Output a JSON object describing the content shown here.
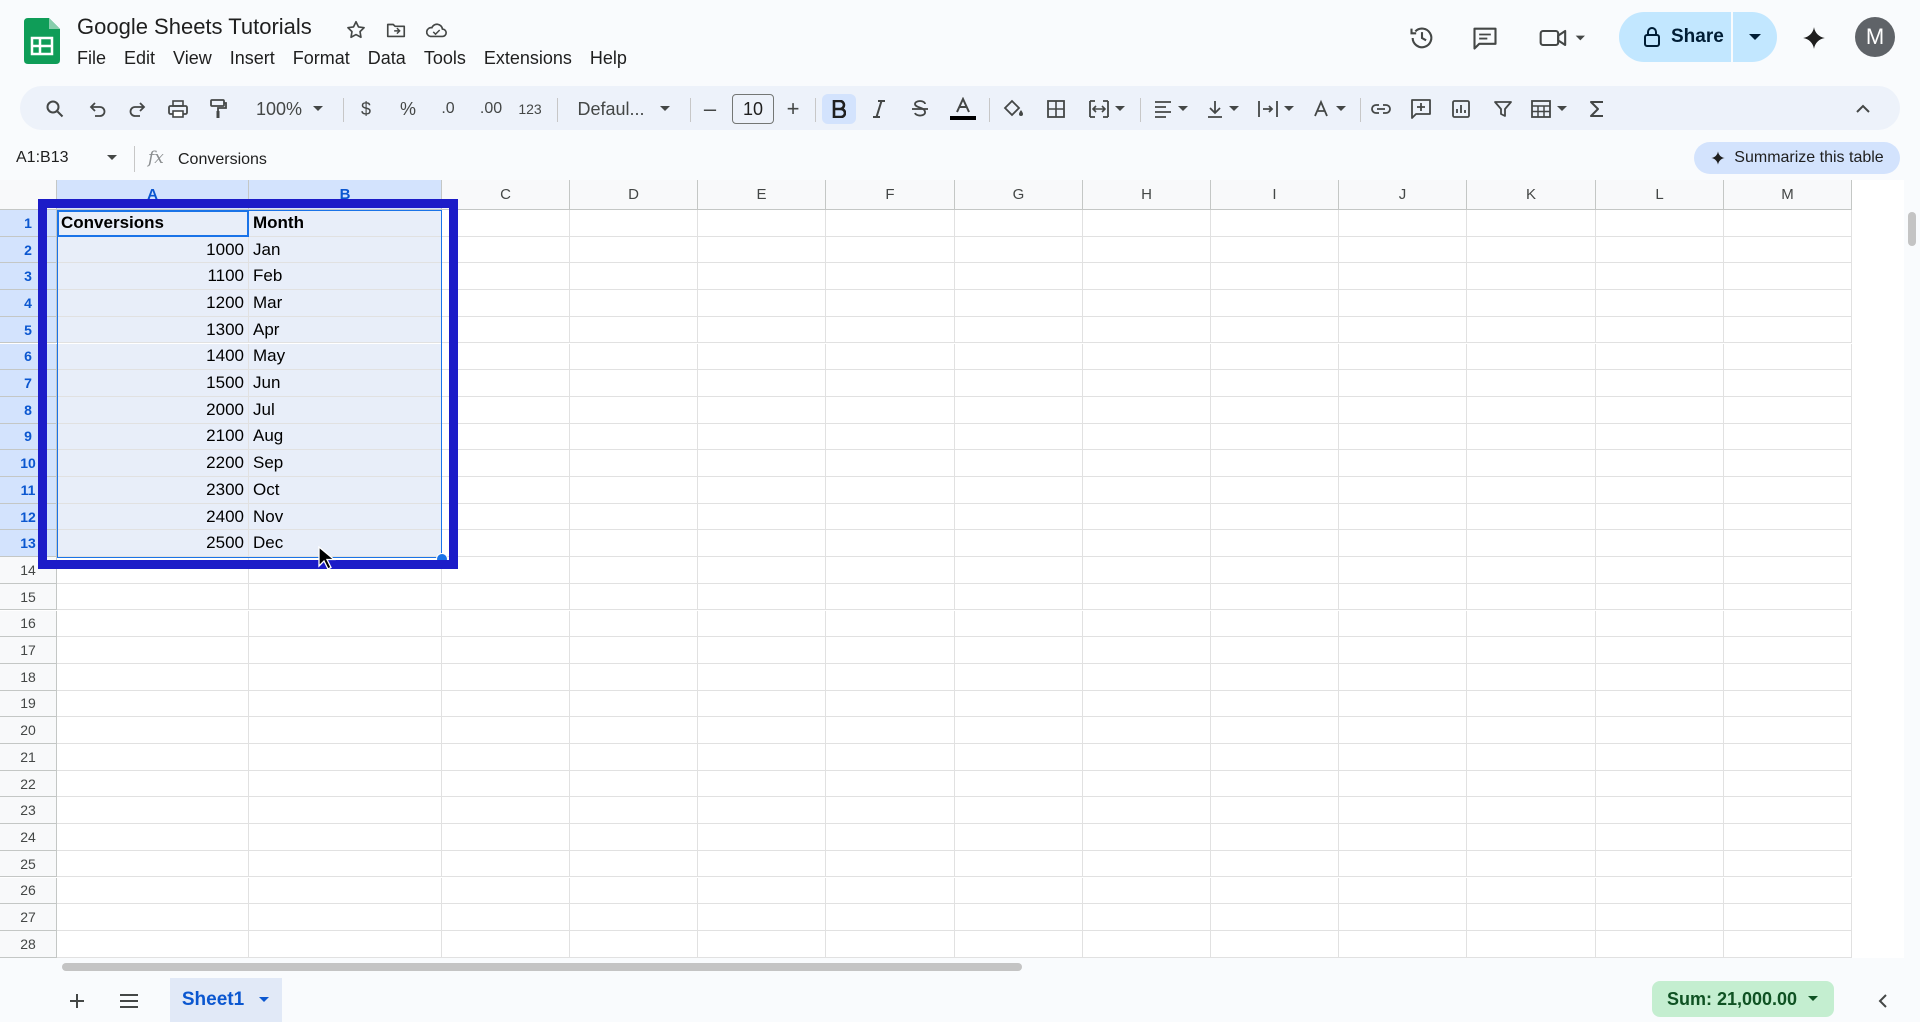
{
  "app": {
    "title": "Google Sheets Tutorials",
    "menu": [
      "File",
      "Edit",
      "View",
      "Insert",
      "Format",
      "Data",
      "Tools",
      "Extensions",
      "Help"
    ],
    "avatar_letter": "M",
    "share_label": "Share",
    "brand_color": "#0f9d58"
  },
  "toolbar": {
    "zoom": "100%",
    "currency": "$",
    "percent": "%",
    "decrease_decimal": ".0",
    "increase_decimal": ".00",
    "number_format": "123",
    "font": "Defaul...",
    "font_size": "10",
    "minus": "–",
    "plus": "+"
  },
  "formula_bar": {
    "name_box": "A1:B13",
    "fx": "fx",
    "content": "Conversions",
    "summarize_label": "Summarize this table"
  },
  "grid": {
    "columns": [
      "A",
      "B",
      "C",
      "D",
      "E",
      "F",
      "G",
      "H",
      "I",
      "J",
      "K",
      "L",
      "M"
    ],
    "row_numbers": [
      "1",
      "2",
      "3",
      "4",
      "5",
      "6",
      "7",
      "8",
      "9",
      "10",
      "11",
      "12",
      "13",
      "14",
      "15",
      "16",
      "17",
      "18",
      "19",
      "20",
      "21",
      "22",
      "23",
      "24",
      "25",
      "26",
      "27",
      "28"
    ],
    "headers": [
      "Conversions",
      "Month"
    ],
    "rows": [
      [
        "1000",
        "Jan"
      ],
      [
        "1100",
        "Feb"
      ],
      [
        "1200",
        "Mar"
      ],
      [
        "1300",
        "Apr"
      ],
      [
        "1400",
        "May"
      ],
      [
        "1500",
        "Jun"
      ],
      [
        "2000",
        "Jul"
      ],
      [
        "2100",
        "Aug"
      ],
      [
        "2200",
        "Sep"
      ],
      [
        "2300",
        "Oct"
      ],
      [
        "2400",
        "Nov"
      ],
      [
        "2500",
        "Dec"
      ]
    ],
    "selection_color": "#1a73e8",
    "annotation_color": "#1c1cc8"
  },
  "bottom_bar": {
    "sheet_tab": "Sheet1",
    "sum_label": "Sum: 21,000.00",
    "sum_color": "#c4eed0"
  }
}
